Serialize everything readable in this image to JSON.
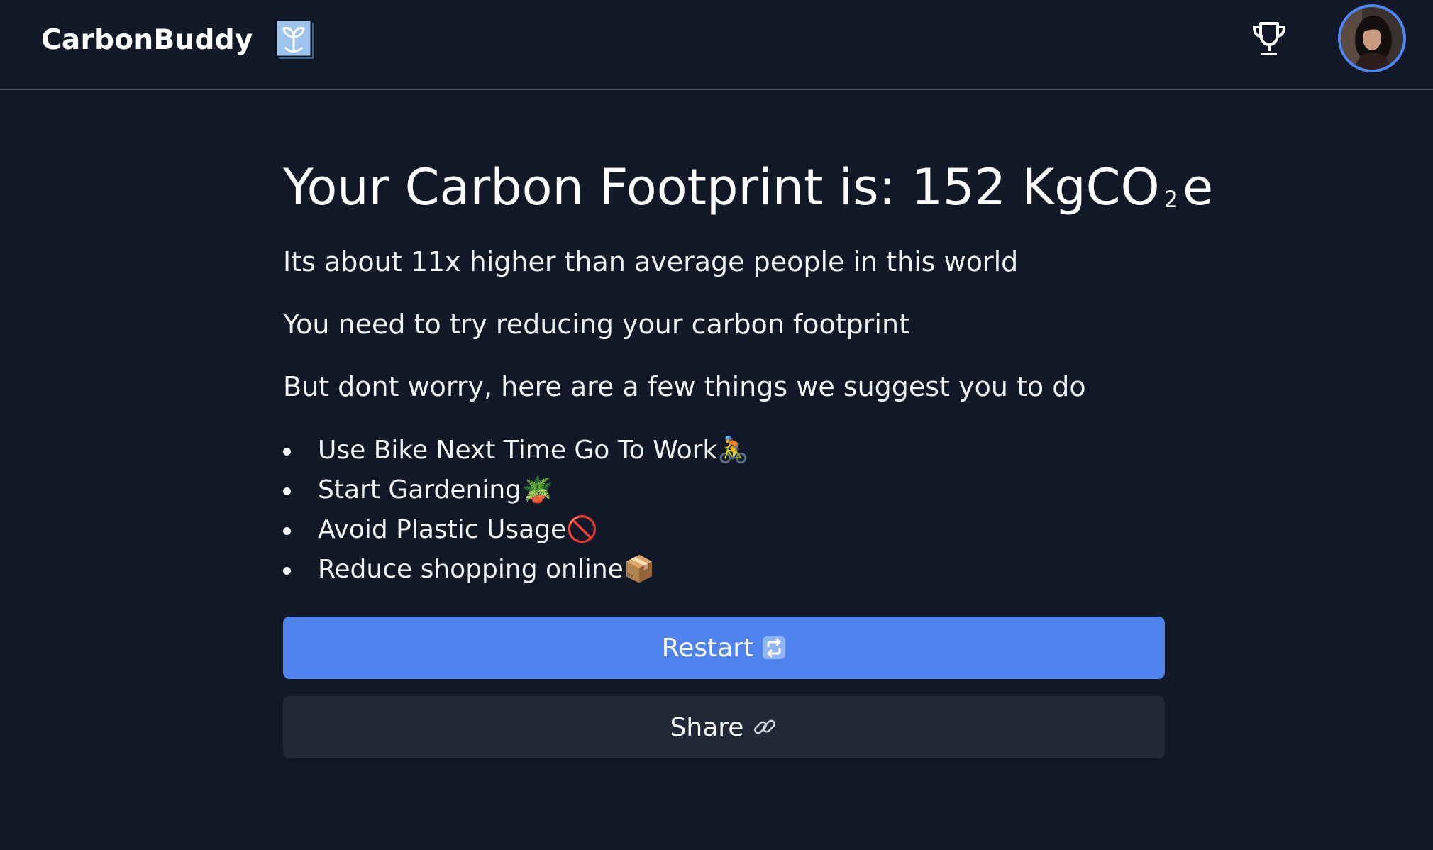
{
  "nav": {
    "brand": "CarbonBuddy",
    "brand_icon": "sprout-box-icon",
    "trophy_icon": "trophy-icon",
    "avatar_icon": "user-avatar"
  },
  "result": {
    "headline_prefix": "Your Carbon Footprint is: 152 KgCO",
    "headline_sub": "2",
    "headline_suffix": "e",
    "line1": "Its about 11x higher than average people in this world",
    "line2": "You need to try reducing your carbon footprint",
    "line3": "But dont worry, here are a few things we suggest you to do"
  },
  "suggestions": [
    {
      "text": "Use Bike Next Time Go To Work",
      "emoji": "🚴"
    },
    {
      "text": "Start Gardening",
      "emoji": "🪴"
    },
    {
      "text": "Avoid Plastic Usage",
      "emoji": "🚫"
    },
    {
      "text": "Reduce shopping online",
      "emoji": "📦"
    }
  ],
  "buttons": {
    "restart_label": "Restart",
    "restart_icon": "repeat-icon",
    "share_label": "Share",
    "share_icon": "link-icon"
  },
  "colors": {
    "background": "#111827",
    "primary": "#4f83ee",
    "secondary": "#1f2937"
  }
}
